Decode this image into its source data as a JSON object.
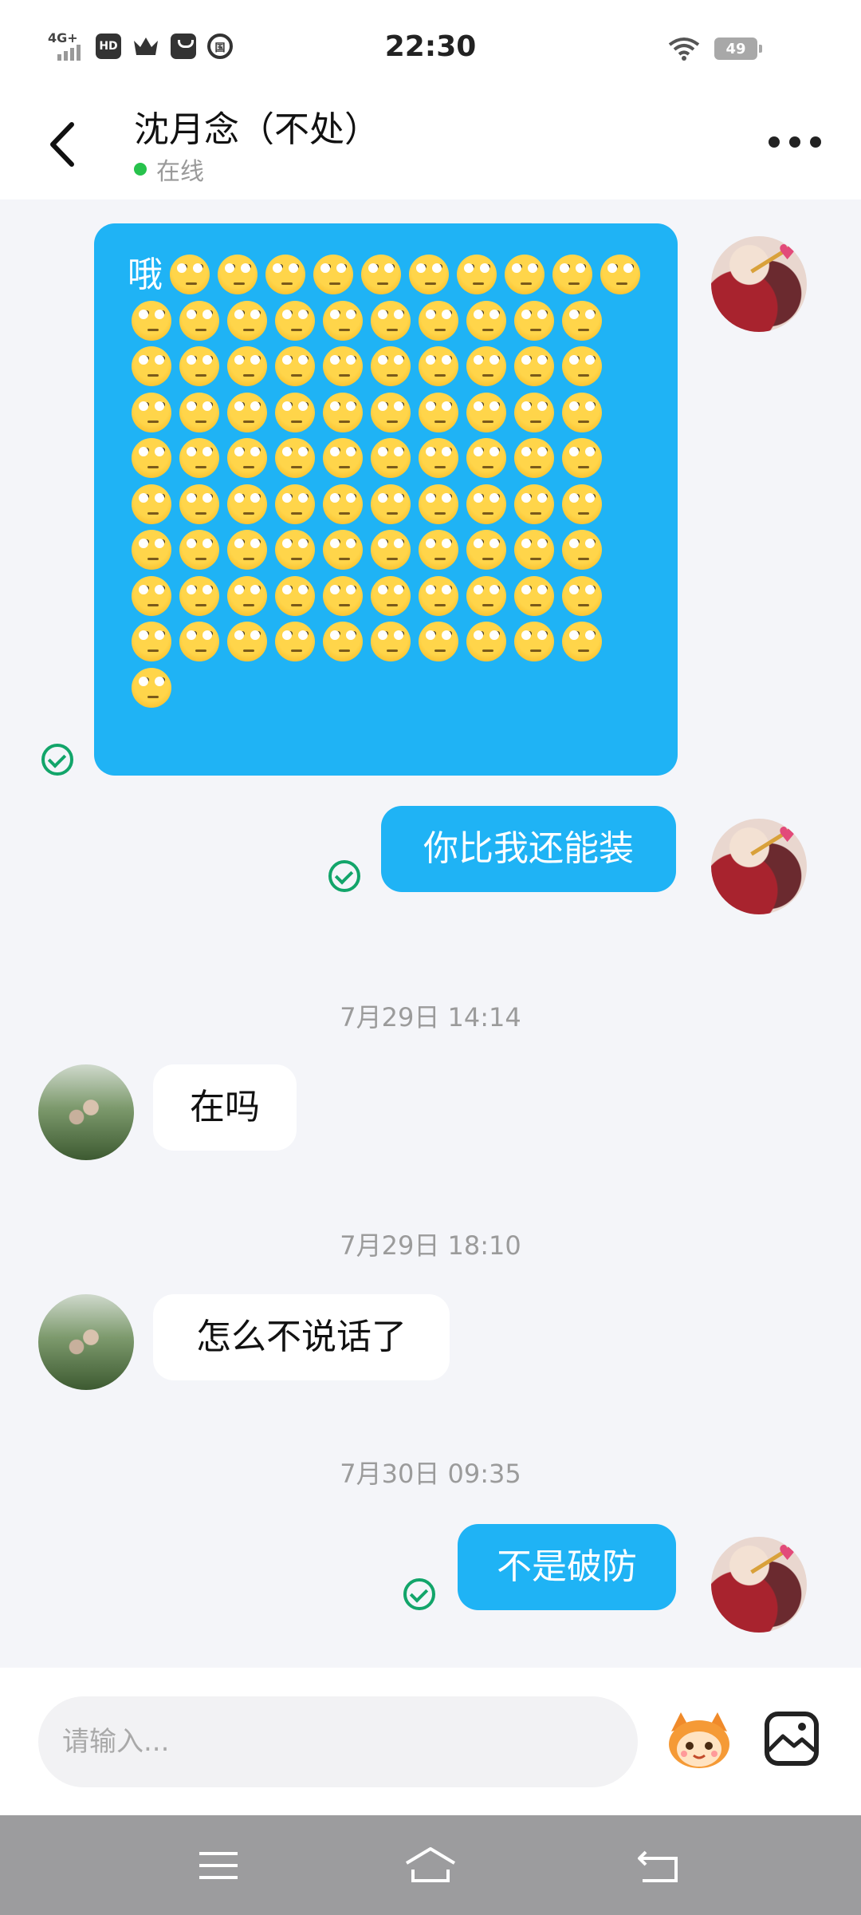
{
  "status_bar": {
    "network": "4G+",
    "hd": "HD",
    "coin": "国",
    "time": "22:30",
    "battery": "49"
  },
  "header": {
    "title": "沈月念（不处）",
    "status": "在线"
  },
  "messages": [
    {
      "sender": "self",
      "first_char": "哦",
      "emoji_name": "face-with-rolling-eyes",
      "emoji_count": 91,
      "status": "read"
    },
    {
      "sender": "self",
      "text": "你比我还能装",
      "status": "read"
    },
    {
      "type": "timestamp",
      "text": "7月29日 14:14"
    },
    {
      "sender": "peer",
      "text": "在吗"
    },
    {
      "type": "timestamp",
      "text": "7月29日 18:10"
    },
    {
      "sender": "peer",
      "text": "怎么不说话了"
    },
    {
      "type": "timestamp",
      "text": "7月30日 09:35"
    },
    {
      "sender": "self",
      "text": "不是破防",
      "status": "read"
    }
  ],
  "composer": {
    "placeholder": "请输入...",
    "emoji_button_icon": "mascot-icon",
    "image_button_icon": "image-icon"
  },
  "nav": {
    "icons": [
      "menu-icon",
      "home-icon",
      "back-icon"
    ]
  },
  "colors": {
    "self_bubble": "#1fb3f5",
    "peer_bubble": "#ffffff",
    "read_check": "#12a56a",
    "online_dot": "#27c24c",
    "background": "#f4f5f9"
  }
}
